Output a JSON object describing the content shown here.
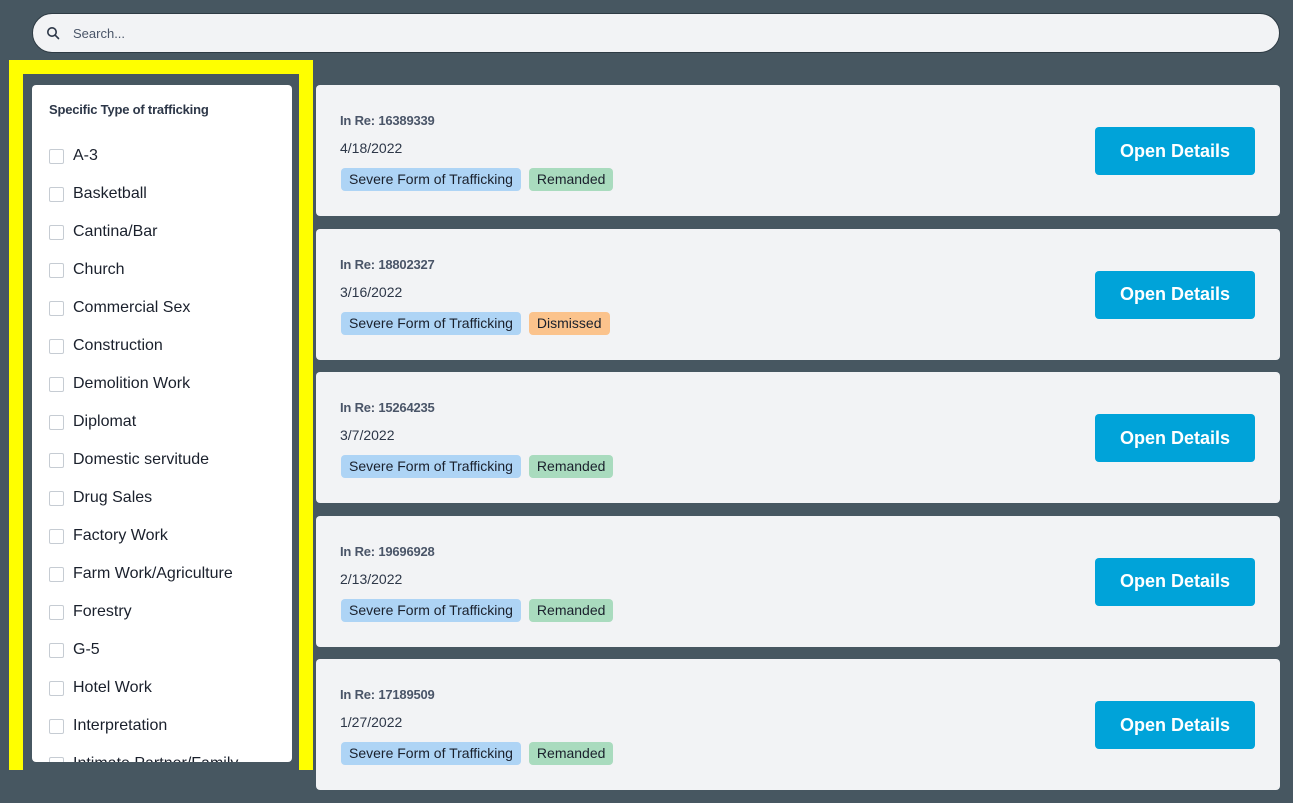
{
  "search": {
    "placeholder": "Search..."
  },
  "filter": {
    "title": "Specific Type of trafficking",
    "options": [
      "A-3",
      "Basketball",
      "Cantina/Bar",
      "Church",
      "Commercial Sex",
      "Construction",
      "Demolition Work",
      "Diplomat",
      "Domestic servitude",
      "Drug Sales",
      "Factory Work",
      "Farm Work/Agriculture",
      "Forestry",
      "G-5",
      "Hotel Work",
      "Interpretation",
      "Intimate Partner/Family"
    ]
  },
  "cases": [
    {
      "title": "In Re: 16389339",
      "date": "4/18/2022",
      "type_tag": "Severe Form of Trafficking",
      "status_tag": "Remanded",
      "button": "Open Details"
    },
    {
      "title": "In Re: 18802327",
      "date": "3/16/2022",
      "type_tag": "Severe Form of Trafficking",
      "status_tag": "Dismissed",
      "button": "Open Details"
    },
    {
      "title": "In Re: 15264235",
      "date": "3/7/2022",
      "type_tag": "Severe Form of Trafficking",
      "status_tag": "Remanded",
      "button": "Open Details"
    },
    {
      "title": "In Re: 19696928",
      "date": "2/13/2022",
      "type_tag": "Severe Form of Trafficking",
      "status_tag": "Remanded",
      "button": "Open Details"
    },
    {
      "title": "In Re: 17189509",
      "date": "1/27/2022",
      "type_tag": "Severe Form of Trafficking",
      "status_tag": "Remanded",
      "button": "Open Details"
    }
  ],
  "colors": {
    "background": "#475761",
    "highlight": "#ffff00",
    "button": "#00a3d9",
    "tag_type": "#aed4f5",
    "tag_remanded": "#a9dbbe",
    "tag_dismissed": "#fbc38c"
  }
}
